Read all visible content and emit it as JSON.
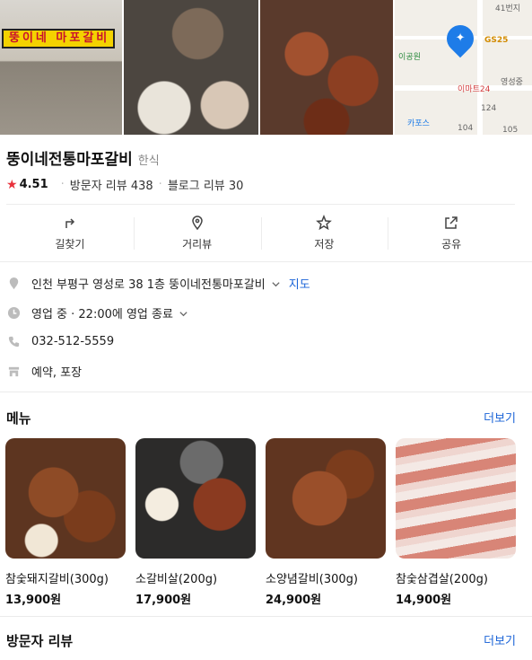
{
  "photos": {
    "sign_text": "뚱이네 마포갈비",
    "map_labels": [
      "GS25",
      "이공원",
      "이마트24",
      "영성중",
      "카포스",
      "124",
      "104",
      "105",
      "41번지"
    ]
  },
  "place": {
    "name": "뚱이네전통마포갈비",
    "category": "한식",
    "rating": "4.51",
    "visitor_reviews": "방문자 리뷰 438",
    "blog_reviews": "블로그 리뷰 30"
  },
  "actions": [
    {
      "label": "길찾기",
      "icon": "directions-icon"
    },
    {
      "label": "거리뷰",
      "icon": "pin-outline-icon"
    },
    {
      "label": "저장",
      "icon": "star-outline-icon"
    },
    {
      "label": "공유",
      "icon": "share-icon"
    }
  ],
  "info": {
    "address": "인천 부평구 영성로 38 1층 뚱이네전통마포갈비",
    "map_link": "지도",
    "hours": "영업 중 · 22:00에 영업 종료",
    "phone": "032-512-5559",
    "services": "예약, 포장"
  },
  "menu": {
    "title": "메뉴",
    "more": "더보기",
    "items": [
      {
        "name": "참숯돼지갈비(300g)",
        "price": "13,900원"
      },
      {
        "name": "소갈비살(200g)",
        "price": "17,900원"
      },
      {
        "name": "소양념갈비(300g)",
        "price": "24,900원"
      },
      {
        "name": "참숯삼겹살(200g)",
        "price": "14,900원"
      }
    ]
  },
  "reviews": {
    "title": "방문자 리뷰",
    "more": "더보기"
  },
  "colors": {
    "accent_blue": "#1a63d7",
    "star_red": "#e8313b"
  }
}
